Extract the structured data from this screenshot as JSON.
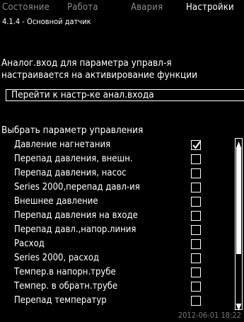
{
  "tabs": [
    {
      "label": "Состояние",
      "active": false
    },
    {
      "label": "Работа",
      "active": false
    },
    {
      "label": "Авария",
      "active": false
    },
    {
      "label": "Настройки",
      "active": true
    }
  ],
  "path": "4.1.4 - Основной датчик",
  "description": {
    "line1": "Аналог.вход для параметра управл-я",
    "line2": "настраивается на активирование функции"
  },
  "goto_button": "Перейти к настр-ке анал.входа",
  "select_title": "Выбрать параметр управления",
  "options": [
    {
      "label": "Давление нагнетания",
      "checked": true
    },
    {
      "label": "Перепад давления, внешн.",
      "checked": false
    },
    {
      "label": "Перепад давления, насос",
      "checked": false
    },
    {
      "label": "Series 2000,перепад давл-ия",
      "checked": false
    },
    {
      "label": "Внешнее давление",
      "checked": false
    },
    {
      "label": "Перепад давления на входе",
      "checked": false
    },
    {
      "label": "Перепад давл.,напор.линия",
      "checked": false
    },
    {
      "label": "Расход",
      "checked": false
    },
    {
      "label": "Series 2000, расход",
      "checked": false
    },
    {
      "label": "Темпер.в напорн.трубе",
      "checked": false
    },
    {
      "label": "Темпер. в обратн.трубе",
      "checked": false
    },
    {
      "label": "Перепад температур",
      "checked": false
    }
  ],
  "datetime": "2012-06-01 18:22",
  "colors": {
    "background": "#000000",
    "foreground": "#ffffff",
    "dim": "#8a8a8a"
  }
}
